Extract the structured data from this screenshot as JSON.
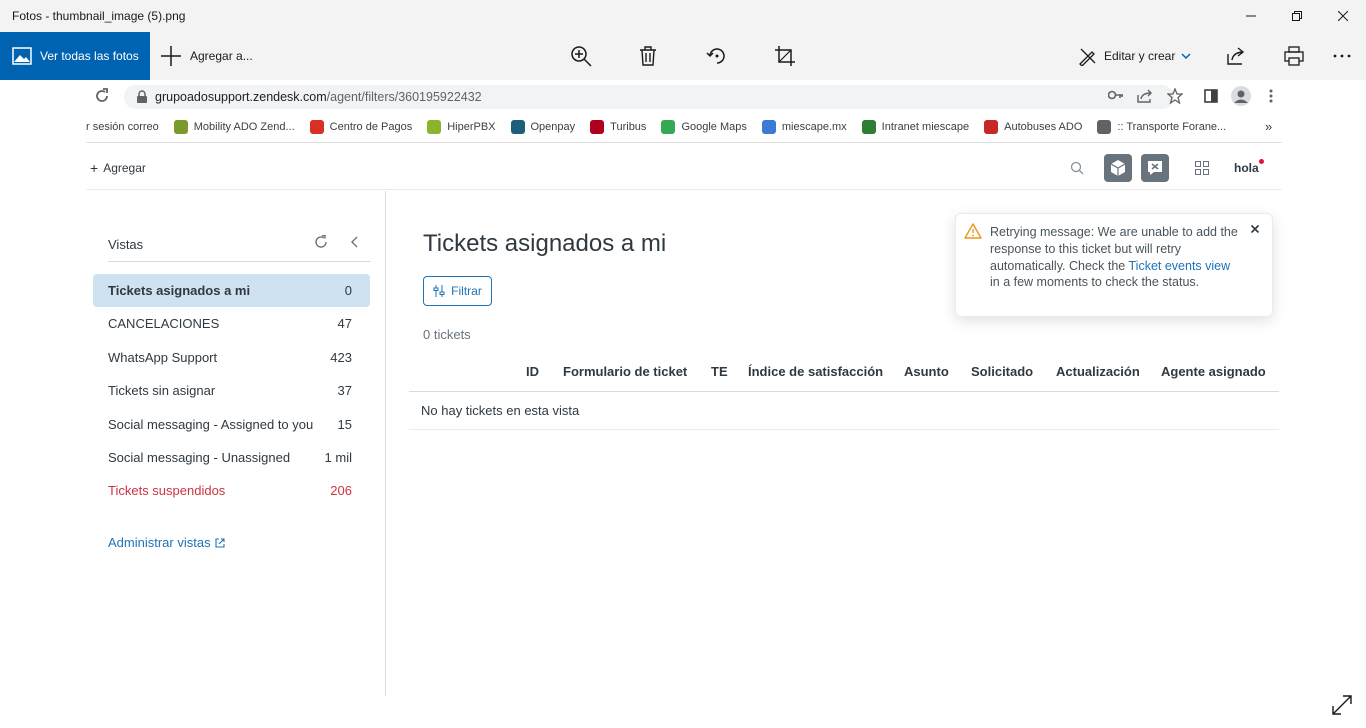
{
  "app": {
    "window_title": "Fotos - thumbnail_image (5).png",
    "toolbar": {
      "all_photos": "Ver todas las fotos",
      "add": "Agregar a...",
      "edit_create": "Editar y crear",
      "icons": [
        "zoom-in-icon",
        "trash-icon",
        "rotate-icon",
        "crop-icon",
        "share-icon",
        "print-icon",
        "more-icon"
      ]
    }
  },
  "browser": {
    "url_host": "grupoadosupport.zendesk.com",
    "url_path": "/agent/filters/360195922432",
    "bookmarks": [
      {
        "label": "r sesión correo",
        "color": ""
      },
      {
        "label": "Mobility ADO Zend...",
        "color": "#7a9a2c"
      },
      {
        "label": "Centro de Pagos",
        "color": "#d93025"
      },
      {
        "label": "HiperPBX",
        "color": "#8ab42a"
      },
      {
        "label": "Openpay",
        "color": "#1b5f7a"
      },
      {
        "label": "Turibus",
        "color": "#b00020"
      },
      {
        "label": "Google Maps",
        "color": "#34a853"
      },
      {
        "label": "miescape.mx",
        "color": "#3a7bd5"
      },
      {
        "label": "Intranet miescape",
        "color": "#2e7d32"
      },
      {
        "label": "Autobuses ADO",
        "color": "#c62828"
      },
      {
        "label": ":: Transporte Forane...",
        "color": "#5f6368"
      }
    ]
  },
  "zendesk": {
    "header": {
      "add_label": "Agregar",
      "brand_text": "hola"
    },
    "sidebar": {
      "title": "Vistas",
      "items": [
        {
          "label": "Tickets asignados a mi",
          "count": "0",
          "active": true
        },
        {
          "label": "CANCELACIONES",
          "count": "47"
        },
        {
          "label": "WhatsApp Support",
          "count": "423"
        },
        {
          "label": "Tickets sin asignar",
          "count": "37"
        },
        {
          "label": "Social messaging - Assigned to you",
          "count": "15"
        },
        {
          "label": "Social messaging - Unassigned",
          "count": "1 mil"
        },
        {
          "label": "Tickets suspendidos",
          "count": "206",
          "alert": true
        }
      ],
      "manage_label": "Administrar vistas"
    },
    "main": {
      "title": "Tickets asignados a mi",
      "filter_label": "Filtrar",
      "ticket_count": "0 tickets",
      "columns": [
        "ID",
        "Formulario de ticket",
        "TE",
        "Índice de satisfacción",
        "Asunto",
        "Solicitado",
        "Actualización",
        "Agente asignado"
      ],
      "empty_message": "No hay tickets en esta vista"
    },
    "notification": {
      "text_before": "Retrying message: We are unable to add the response to this ticket but will retry automatically. Check the ",
      "link": "Ticket events view",
      "text_after": " in a few moments to check the status."
    }
  },
  "colors": {
    "photos_accent": "#0063b1",
    "link": "#1f73b7",
    "active_view_bg": "#cee2f2",
    "alert": "#cc3340"
  }
}
